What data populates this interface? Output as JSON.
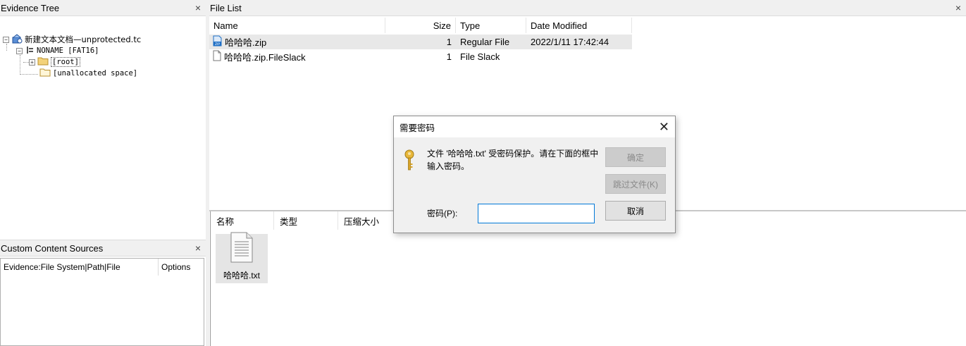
{
  "evidence_tree": {
    "title": "Evidence Tree",
    "close_label": "×",
    "expander_collapse": "−",
    "expander_expand": "+",
    "nodes": [
      {
        "label": "新建文本文档—unprotected.tc"
      },
      {
        "label": "NONAME [FAT16]"
      },
      {
        "label": "[root]"
      },
      {
        "label": "[unallocated space]"
      }
    ]
  },
  "file_list": {
    "title": "File List",
    "close_label": "×",
    "columns": {
      "name": "Name",
      "size": "Size",
      "type": "Type",
      "modified": "Date Modified"
    },
    "rows": [
      {
        "name": "哈哈哈.zip",
        "size": "1",
        "type": "Regular File",
        "modified": "2022/1/11 17:42:44",
        "icon": "zip-file-icon"
      },
      {
        "name": "哈哈哈.zip.FileSlack",
        "size": "1",
        "type": "File Slack",
        "modified": "",
        "icon": "document-icon"
      }
    ]
  },
  "archive_view": {
    "columns": {
      "name": "名称",
      "type": "类型",
      "compressed": "压缩大小"
    },
    "items": [
      {
        "name": "哈哈哈.txt",
        "icon": "text-file-icon"
      }
    ]
  },
  "custom_sources": {
    "title": "Custom Content Sources",
    "close_label": "×",
    "columns": {
      "evidence": "Evidence:File System|Path|File",
      "options": "Options"
    }
  },
  "password_dialog": {
    "title": "需要密码",
    "close_label": "✕",
    "message": "文件 '哈哈哈.txt' 受密码保护。请在下面的框中输入密码。",
    "password_label": "密码(P):",
    "password_value": "",
    "ok_label": "确定",
    "skip_label": "跳过文件(K)",
    "cancel_label": "取消",
    "icon": "key-icon"
  },
  "colors": {
    "dialog_input_border": "#0078d7",
    "selected_row": "#e8e8e8",
    "zip_icon_blue": "#1f6fc5",
    "folder_yellow": "#f3d27a"
  }
}
